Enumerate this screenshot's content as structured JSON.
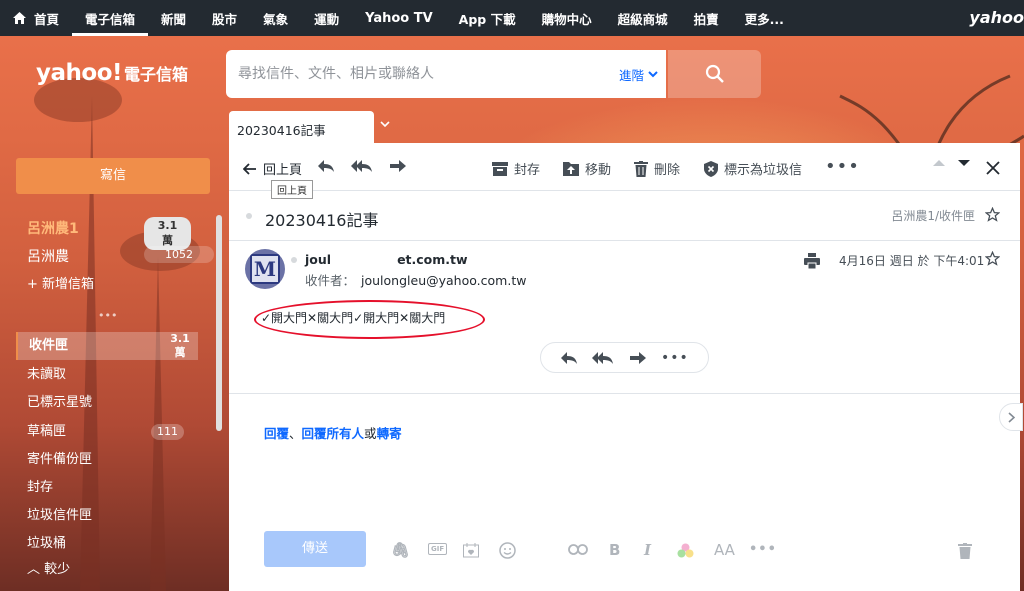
{
  "topnav": {
    "items": [
      "首頁",
      "電子信箱",
      "新聞",
      "股市",
      "氣象",
      "運動",
      "Yahoo TV",
      "App 下載",
      "購物中心",
      "超級商城",
      "拍賣",
      "更多..."
    ],
    "brand": "yahoo"
  },
  "logo": {
    "brand": "yahoo!",
    "product": "電子信箱"
  },
  "search": {
    "placeholder": "尋找信件、文件、相片或聯絡人",
    "advanced": "進階"
  },
  "tab": {
    "label": "20230416記事"
  },
  "sidebar": {
    "compose": "寫信",
    "accounts": [
      {
        "name": "呂洲農1",
        "count": "3.1萬"
      },
      {
        "name": "呂洲農",
        "count": "1052"
      }
    ],
    "add_mailbox": "新增信箱",
    "folders": [
      {
        "label": "收件匣",
        "count": "3.1 萬"
      },
      {
        "label": "未讀取"
      },
      {
        "label": "已標示星號"
      },
      {
        "label": "草稿匣",
        "count": "111"
      },
      {
        "label": "寄件備份匣"
      },
      {
        "label": "封存"
      },
      {
        "label": "垃圾信件匣"
      },
      {
        "label": "垃圾桶"
      }
    ],
    "less": "較少"
  },
  "toolbar": {
    "back": "回上頁",
    "archive": "封存",
    "move": "移動",
    "delete": "刪除",
    "spam": "標示為垃圾信",
    "tooltip": "回上頁"
  },
  "message": {
    "subject": "20230416記事",
    "folder": "呂洲農1/收件匣",
    "sender_prefix": "joul",
    "sender_suffix": "et.com.tw",
    "to_label": "收件者：",
    "to": "joulongleu@yahoo.com.tw",
    "date": "4月16日 週日 於 下午4:01",
    "body": "✓開大門✕關大門✓開大門✕關大門"
  },
  "reply": {
    "reply": "回覆",
    "sep": "、",
    "reply_all": "回覆所有人",
    "or": "或",
    "forward": "轉寄",
    "send": "傳送"
  },
  "colors": {
    "accent": "#f08e4a",
    "link": "#0f69ff",
    "topnav": "#232a31",
    "highlight": "#e5102b"
  }
}
